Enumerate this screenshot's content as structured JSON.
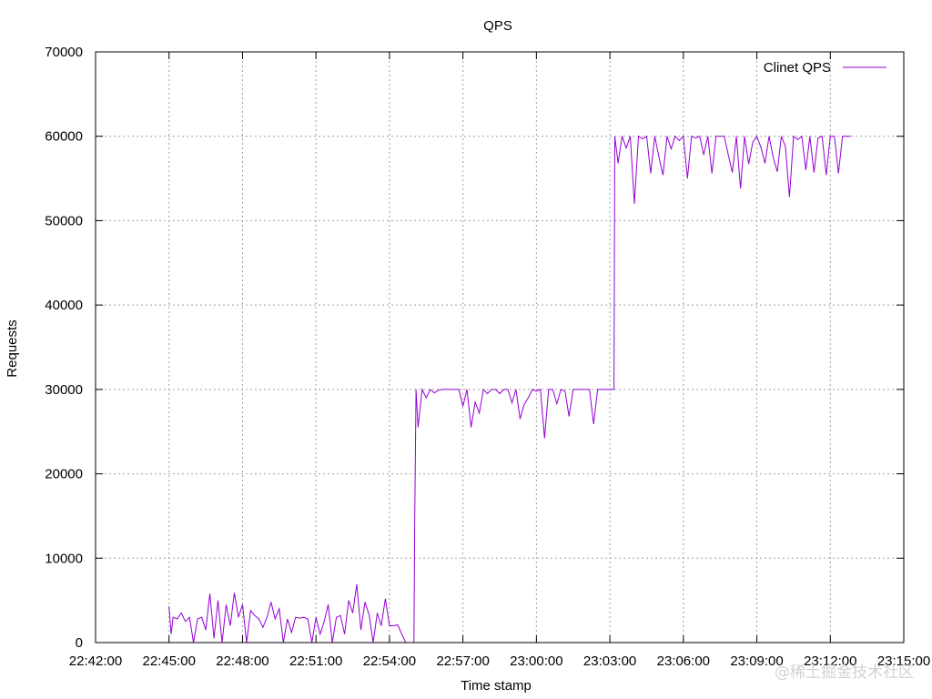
{
  "chart_data": {
    "type": "line",
    "title": "QPS",
    "xlabel": "Time stamp",
    "ylabel": "Requests",
    "xlim": [
      "22:42:00",
      "23:15:00"
    ],
    "ylim": [
      0,
      70000
    ],
    "x_ticks": [
      "22:42:00",
      "22:45:00",
      "22:48:00",
      "22:51:00",
      "22:54:00",
      "22:57:00",
      "23:00:00",
      "23:03:00",
      "23:06:00",
      "23:09:00",
      "23:12:00",
      "23:15:00"
    ],
    "y_ticks": [
      "0",
      "10000",
      "20000",
      "30000",
      "40000",
      "50000",
      "60000",
      "70000"
    ],
    "grid": true,
    "legend": "top-right",
    "series": [
      {
        "name": "Clinet QPS",
        "color": "#9400d3",
        "x": [
          "22:45:00",
          "22:45:05",
          "22:45:10",
          "22:45:20",
          "22:45:30",
          "22:45:40",
          "22:45:50",
          "22:46:00",
          "22:46:10",
          "22:46:20",
          "22:46:30",
          "22:46:40",
          "22:46:50",
          "22:47:00",
          "22:47:10",
          "22:47:20",
          "22:47:30",
          "22:47:40",
          "22:47:50",
          "22:48:00",
          "22:48:10",
          "22:48:20",
          "22:48:30",
          "22:48:40",
          "22:48:50",
          "22:49:00",
          "22:49:10",
          "22:49:20",
          "22:49:30",
          "22:49:40",
          "22:49:50",
          "22:50:00",
          "22:50:10",
          "22:50:20",
          "22:50:30",
          "22:50:40",
          "22:50:50",
          "22:51:00",
          "22:51:10",
          "22:51:20",
          "22:51:30",
          "22:51:40",
          "22:51:50",
          "22:52:00",
          "22:52:10",
          "22:52:20",
          "22:52:30",
          "22:52:40",
          "22:52:50",
          "22:53:00",
          "22:53:10",
          "22:53:20",
          "22:53:30",
          "22:53:40",
          "22:53:50",
          "22:54:00",
          "22:54:10",
          "22:54:20",
          "22:54:30",
          "22:54:40",
          "22:54:50",
          "22:55:00",
          "22:55:02",
          "22:55:05",
          "22:55:10",
          "22:55:20",
          "22:55:30",
          "22:55:40",
          "22:55:50",
          "22:56:00",
          "22:56:10",
          "22:56:20",
          "22:56:30",
          "22:56:40",
          "22:56:50",
          "22:57:00",
          "22:57:10",
          "22:57:20",
          "22:57:30",
          "22:57:40",
          "22:57:50",
          "22:58:00",
          "22:58:10",
          "22:58:20",
          "22:58:30",
          "22:58:40",
          "22:58:50",
          "22:59:00",
          "22:59:10",
          "22:59:20",
          "22:59:30",
          "22:59:40",
          "22:59:50",
          "23:00:00",
          "23:00:10",
          "23:00:20",
          "23:00:30",
          "23:00:40",
          "23:00:50",
          "23:01:00",
          "23:01:10",
          "23:01:20",
          "23:01:30",
          "23:01:40",
          "23:01:50",
          "23:02:00",
          "23:02:10",
          "23:02:20",
          "23:02:30",
          "23:02:40",
          "23:02:50",
          "23:03:00",
          "23:03:10",
          "23:03:12",
          "23:03:20",
          "23:03:30",
          "23:03:40",
          "23:03:50",
          "23:04:00",
          "23:04:10",
          "23:04:20",
          "23:04:30",
          "23:04:40",
          "23:04:50",
          "23:05:00",
          "23:05:10",
          "23:05:20",
          "23:05:30",
          "23:05:40",
          "23:05:50",
          "23:06:00",
          "23:06:10",
          "23:06:20",
          "23:06:30",
          "23:06:40",
          "23:06:50",
          "23:07:00",
          "23:07:10",
          "23:07:20",
          "23:07:30",
          "23:07:40",
          "23:07:50",
          "23:08:00",
          "23:08:10",
          "23:08:20",
          "23:08:30",
          "23:08:40",
          "23:08:50",
          "23:09:00",
          "23:09:10",
          "23:09:20",
          "23:09:30",
          "23:09:40",
          "23:09:50",
          "23:10:00",
          "23:10:10",
          "23:10:20",
          "23:10:30",
          "23:10:40",
          "23:10:50",
          "23:11:00",
          "23:11:10",
          "23:11:20",
          "23:11:30",
          "23:11:40",
          "23:11:50",
          "23:12:00",
          "23:12:10",
          "23:12:20",
          "23:12:30",
          "23:12:40",
          "23:12:50"
        ],
        "values": [
          4300,
          1000,
          3000,
          2800,
          3500,
          2500,
          3000,
          0,
          2800,
          3000,
          1500,
          5800,
          500,
          5000,
          0,
          4500,
          2000,
          5900,
          3000,
          4500,
          0,
          3800,
          3200,
          2800,
          1800,
          3000,
          4800,
          2800,
          4000,
          0,
          2800,
          1200,
          3000,
          2900,
          3000,
          2800,
          0,
          3000,
          1000,
          2500,
          4500,
          0,
          3000,
          3200,
          1000,
          5000,
          3500,
          6900,
          1500,
          4800,
          3300,
          0,
          3500,
          2000,
          5200,
          2000,
          2000,
          2100,
          1000,
          0,
          0,
          0,
          15000,
          30000,
          25500,
          30000,
          29000,
          30000,
          29600,
          29900,
          30000,
          30000,
          30000,
          30000,
          30000,
          28000,
          30000,
          25500,
          28500,
          27200,
          30000,
          29500,
          30000,
          30000,
          29500,
          30000,
          30000,
          28400,
          30000,
          26500,
          28200,
          29000,
          30000,
          29800,
          30000,
          24200,
          30000,
          30000,
          28300,
          30000,
          29800,
          26800,
          30000,
          30000,
          30000,
          30000,
          30000,
          25900,
          30000,
          30000,
          30000,
          30000,
          30000,
          60000,
          56800,
          60000,
          58600,
          60000,
          52000,
          60000,
          59700,
          60000,
          55600,
          60000,
          57600,
          55400,
          60000,
          58500,
          60000,
          59500,
          60000,
          55000,
          60000,
          59800,
          60000,
          57800,
          60000,
          55600,
          60000,
          60000,
          60000,
          57800,
          55700,
          60000,
          53800,
          60000,
          56700,
          59300,
          60000,
          58700,
          56800,
          60000,
          57500,
          55800,
          60000,
          58800,
          52800,
          60000,
          59600,
          60000,
          56000,
          60000,
          55700,
          59800,
          60000,
          55400,
          60000,
          60000,
          55600,
          60000,
          60000,
          60000
        ]
      }
    ]
  },
  "watermark": "@稀土掘金技术社区"
}
